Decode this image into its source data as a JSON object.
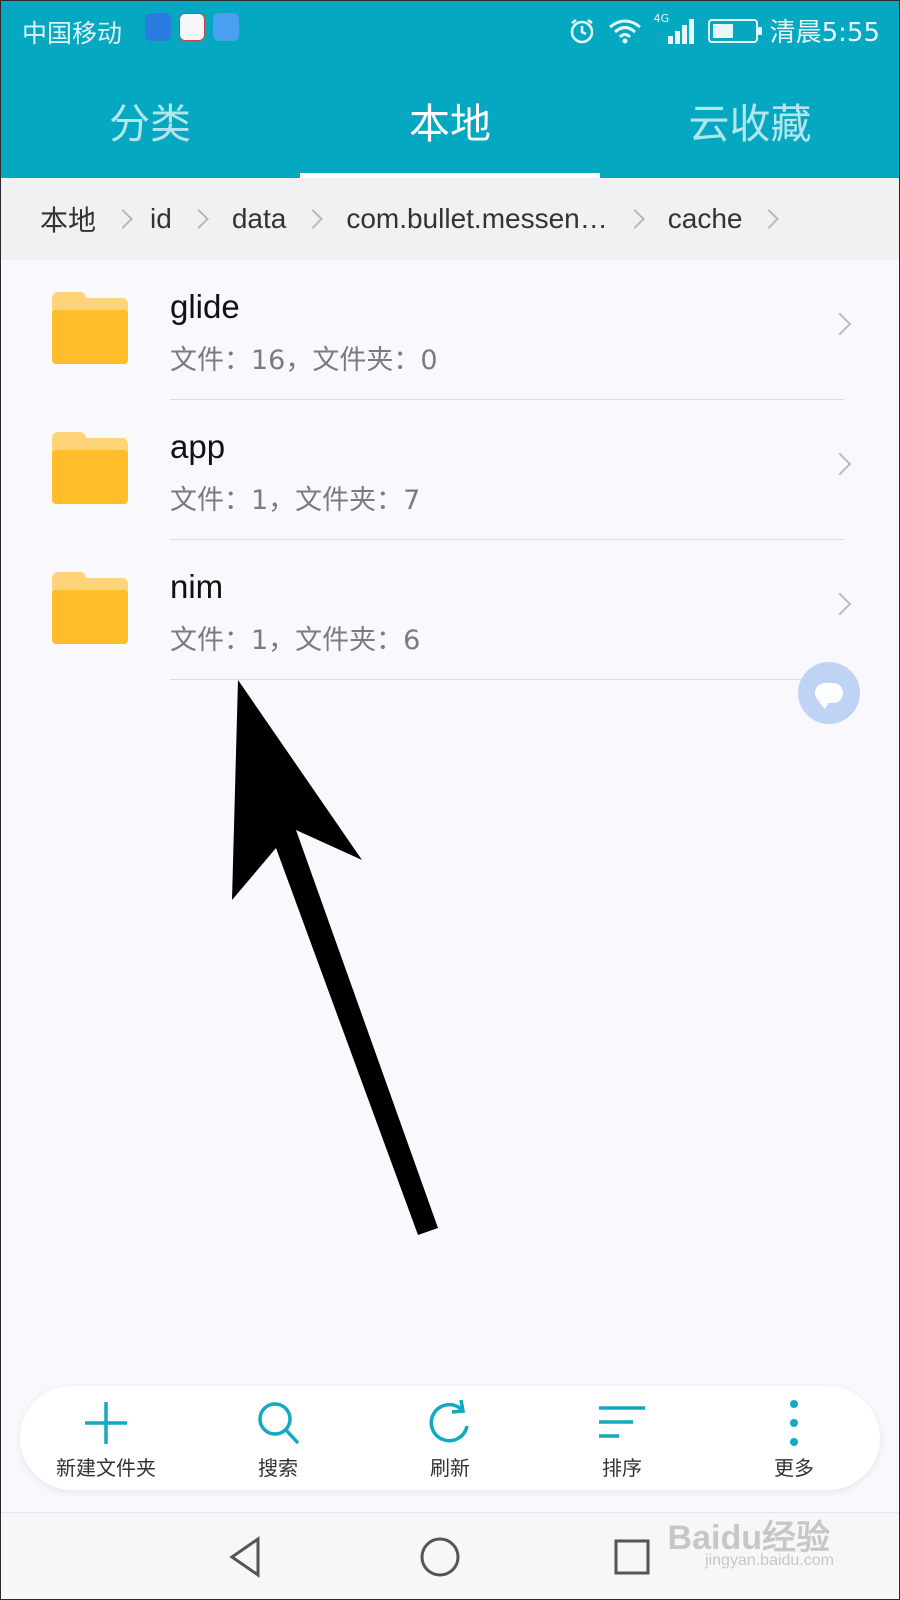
{
  "status_bar": {
    "carrier": "中国移动",
    "time": "清晨5:55",
    "network": "4G",
    "app_icons": [
      "shield-app-icon",
      "robot-app-icon",
      "music-app-icon"
    ]
  },
  "tabs": [
    {
      "label": "分类",
      "active": false
    },
    {
      "label": "本地",
      "active": true
    },
    {
      "label": "云收藏",
      "active": false
    }
  ],
  "breadcrumb": [
    "本地",
    "id",
    "data",
    "com.bullet.messen…",
    "cache"
  ],
  "files": [
    {
      "name": "glide",
      "meta": "文件：16，文件夹：0"
    },
    {
      "name": "app",
      "meta": "文件：1，文件夹：7"
    },
    {
      "name": "nim",
      "meta": "文件：1，文件夹：6"
    }
  ],
  "toolbar": {
    "new_folder": "新建文件夹",
    "search": "搜索",
    "refresh": "刷新",
    "sort": "排序",
    "more": "更多"
  },
  "watermark": {
    "logo": "Baidu经验",
    "url": "jingyan.baidu.com"
  },
  "colors": {
    "accent": "#04a8c0",
    "folder": "#ffbe29",
    "folder_back": "#ffd479",
    "toolbar_icon": "#14a9c2"
  }
}
